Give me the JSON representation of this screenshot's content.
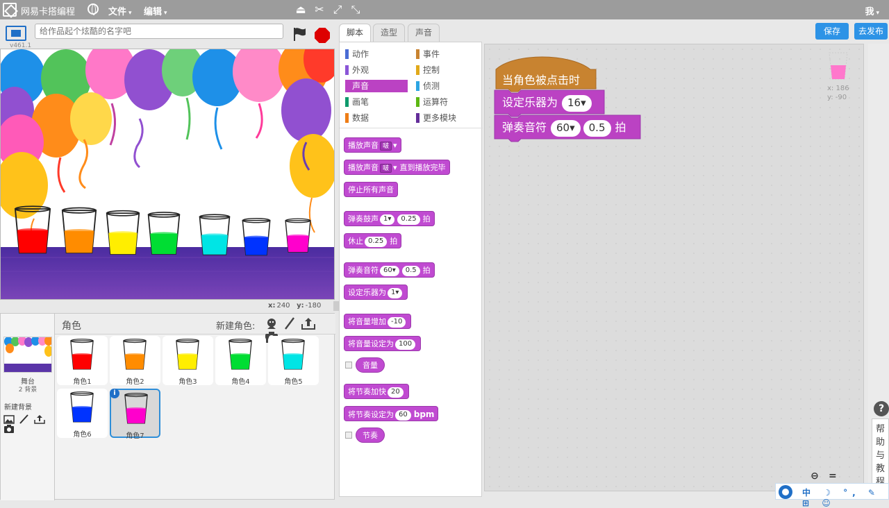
{
  "menubar": {
    "brand": "网易卡搭编程",
    "file_menu": "文件",
    "edit_menu": "编辑",
    "caret": "▾",
    "user": "我"
  },
  "stage_header": {
    "version": "v461.1",
    "title_placeholder": "给作品起个炫酷的名字吧"
  },
  "stage_coords": {
    "x_label": "x:",
    "x_value": "240",
    "y_label": "y:",
    "y_value": "-180"
  },
  "sprites_pane": {
    "title": "角色",
    "new_sprite_label": "新建角色:",
    "stage_label": "舞台",
    "stage_bg_count": "2 背景",
    "new_backdrop_label": "新建背景",
    "sprites": [
      {
        "name": "角色1",
        "color": "#ff0000"
      },
      {
        "name": "角色2",
        "color": "#ff8c00"
      },
      {
        "name": "角色3",
        "color": "#ffee00"
      },
      {
        "name": "角色4",
        "color": "#00dd33"
      },
      {
        "name": "角色5",
        "color": "#00e5e5"
      },
      {
        "name": "角色6",
        "color": "#0033ff"
      },
      {
        "name": "角色7",
        "color": "#ff00cc",
        "selected": true
      }
    ],
    "info_badge": "i"
  },
  "tabs": [
    "脚本",
    "造型",
    "声音"
  ],
  "buttons": {
    "save": "保存",
    "publish": "去发布"
  },
  "categories": [
    {
      "label": "动作",
      "color": "#4a6cd4"
    },
    {
      "label": "事件",
      "color": "#c88330"
    },
    {
      "label": "外观",
      "color": "#8a55d7"
    },
    {
      "label": "控制",
      "color": "#e1a91a"
    },
    {
      "label": "声音",
      "color": "#bb42c3"
    },
    {
      "label": "侦测",
      "color": "#2ca5e2"
    },
    {
      "label": "画笔",
      "color": "#0e9a6c"
    },
    {
      "label": "运算符",
      "color": "#5cb712"
    },
    {
      "label": "数据",
      "color": "#ee7d16"
    },
    {
      "label": "更多模块",
      "color": "#632d99"
    }
  ],
  "blocks": {
    "play_sound": "播放声音",
    "sound_name": "啵",
    "play_sound_until": "播放声音",
    "until_done": "直到播放完毕",
    "stop_all": "停止所有声音",
    "play_drum": "弹奏鼓声",
    "drum_value": "1",
    "drum_beats": "0.25",
    "beats": "拍",
    "rest": "休止",
    "rest_beats": "0.25",
    "play_note": "弹奏音符",
    "note_value": "60",
    "note_beats": "0.5",
    "set_instrument": "设定乐器为",
    "instrument_value": "1",
    "change_volume": "将音量增加",
    "change_volume_value": "-10",
    "set_volume": "将音量设定为",
    "set_volume_value": "100",
    "volume": "音量",
    "change_tempo": "将节奏加快",
    "change_tempo_value": "20",
    "set_tempo": "将节奏设定为",
    "set_tempo_value": "60",
    "bpm": "bpm",
    "tempo": "节奏"
  },
  "script": {
    "hat": "当角色被点击时",
    "set_instrument": "设定乐器为",
    "instrument_value": "16",
    "play_note": "弹奏音符",
    "note_value": "60",
    "note_beats": "0.5",
    "beats": "拍"
  },
  "sprite_info": {
    "x_label": "x:",
    "x_value": "186",
    "y_label": "y:",
    "y_value": "-90"
  },
  "zoom": {
    "out": "−",
    "reset": "=",
    "in": "+"
  },
  "help": {
    "button": "?",
    "text": [
      "帮",
      "助",
      "与",
      "教",
      "程"
    ]
  },
  "ime": {
    "text": "中 ☽ °, ✎ ⊞ ☺"
  }
}
